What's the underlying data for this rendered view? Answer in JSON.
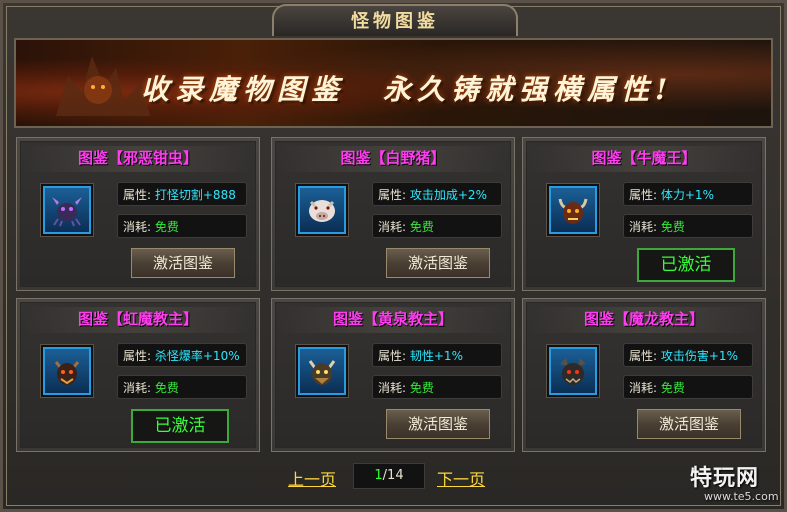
{
  "title": "怪物图鉴",
  "banner": {
    "slogan_left": "收录魔物图鉴",
    "slogan_right": "永久铸就强横属性!"
  },
  "labels": {
    "attr": "属性:",
    "cost": "消耗:"
  },
  "cards": [
    {
      "name": "图鉴【邪恶钳虫】",
      "attr": "打怪切割+888",
      "cost": "免费",
      "action": "激活图鉴",
      "activated": false,
      "icon": "pincer-bug-icon"
    },
    {
      "name": "图鉴【白野猪】",
      "attr": "攻击加成+2%",
      "cost": "免费",
      "action": "激活图鉴",
      "activated": false,
      "icon": "white-boar-icon"
    },
    {
      "name": "图鉴【牛魔王】",
      "attr": "体力+1%",
      "cost": "免费",
      "action": "已激活",
      "activated": true,
      "icon": "bull-demon-king-icon"
    },
    {
      "name": "图鉴【虹魔教主】",
      "attr": "杀怪爆率+10%",
      "cost": "免费",
      "action": "已激活",
      "activated": true,
      "icon": "rainbow-demon-master-icon"
    },
    {
      "name": "图鉴【黄泉教主】",
      "attr": "韧性+1%",
      "cost": "免费",
      "action": "激活图鉴",
      "activated": false,
      "icon": "underworld-master-icon"
    },
    {
      "name": "图鉴【魔龙教主】",
      "attr": "攻击伤害+1%",
      "cost": "免费",
      "action": "激活图鉴",
      "activated": false,
      "icon": "demon-dragon-master-icon"
    }
  ],
  "pager": {
    "prev": "上一页",
    "next": "下一页",
    "current": "1",
    "total": "/14"
  },
  "watermark": {
    "logo": "特玩网",
    "url": "www.te5.com"
  },
  "colors": {
    "title_magenta": "#ff3cf0",
    "attr_cyan": "#2ce8ff",
    "free_green": "#36e83a",
    "pager_yellow": "#ffd83c"
  }
}
